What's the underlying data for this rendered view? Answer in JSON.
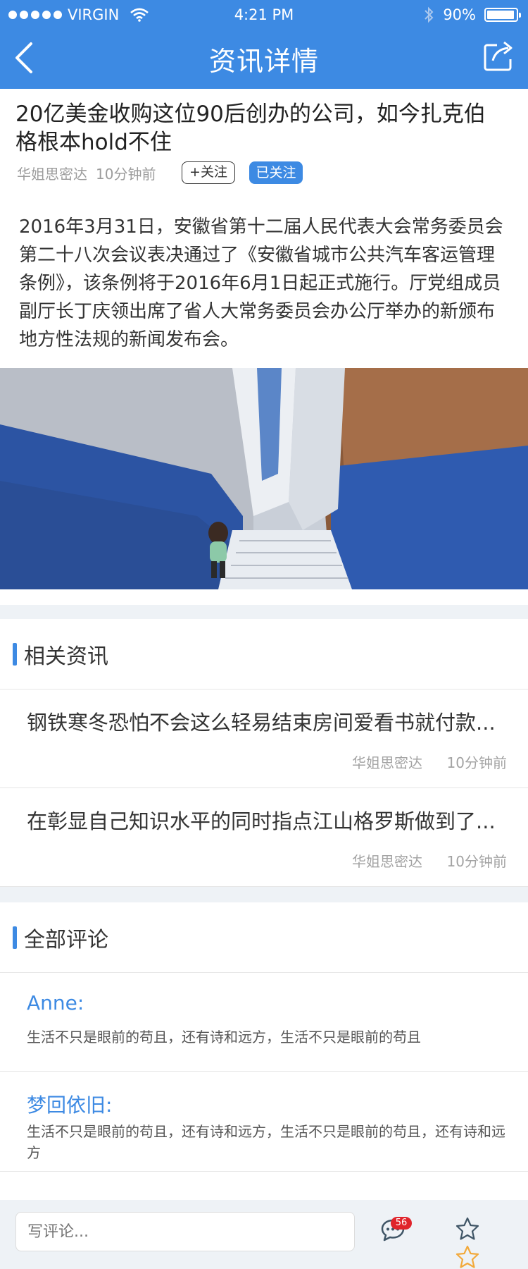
{
  "status_bar": {
    "carrier": "VIRGIN",
    "time": "4:21 PM",
    "battery": "90%"
  },
  "nav": {
    "title": "资讯详情"
  },
  "article": {
    "title": "20亿美金收购这位90后创办的公司，如今扎克伯格根本hold不住",
    "author": "华姐思密达",
    "time": "10分钟前",
    "follow_label": "+关注",
    "followed_label": "已关注",
    "body": "2016年3月31日，安徽省第十二届人民代表大会常务委员会第二十八次会议表决通过了《安徽省城市公共汽车客运管理条例》，该条例将于2016年6月1日起正式施行。厅党组成员副厅长丁庆领出席了省人大常务委员会办公厅举办的新颁布地方性法规的新闻发布会。"
  },
  "related": {
    "heading": "相关资讯",
    "items": [
      {
        "title": "钢铁寒冬恐怕不会这么轻易结束房间爱看书就付款...",
        "source": "华姐思密达",
        "time": "10分钟前"
      },
      {
        "title": "在彰显自己知识水平的同时指点江山格罗斯做到了...",
        "source": "华姐思密达",
        "time": "10分钟前"
      }
    ]
  },
  "comments": {
    "heading": "全部评论",
    "items": [
      {
        "name": "Anne:",
        "text": "生活不只是眼前的苟且，还有诗和远方，生活不只是眼前的苟且"
      },
      {
        "name": "梦回依旧:",
        "text": "生活不只是眼前的苟且，还有诗和远方，生活不只是眼前的苟且，还有诗和远方"
      }
    ]
  },
  "bottom_bar": {
    "input_placeholder": "写评论...",
    "comment_count": "56"
  },
  "colors": {
    "primary": "#3d8ae3",
    "badge": "#e0242b",
    "star": "#f2a93b"
  },
  "icons": [
    "wifi-icon",
    "bluetooth-icon",
    "battery-icon",
    "back-icon",
    "share-icon",
    "comment-icon",
    "star-icon"
  ]
}
